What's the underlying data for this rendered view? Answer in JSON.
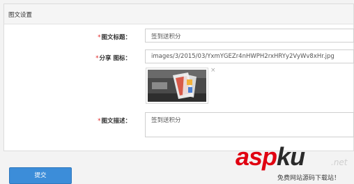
{
  "panel": {
    "title": "图文设置"
  },
  "form": {
    "required_mark": "*",
    "title_label": "图文标题：",
    "title_value": "签到送积分",
    "image_label": "分享 图标：",
    "image_value": "images/3/2015/03/YxmYGEZr4nHWPH2rxHRYy2VyWv8xHr.jpg",
    "remove_glyph": "×",
    "desc_label": "图文描述：",
    "desc_value": "签到送积分"
  },
  "submit_label": "提交",
  "watermark": {
    "text_a": "asp",
    "text_b": "ku",
    "suffix": ".net",
    "subtitle": "免费网站源码下载站！"
  },
  "colors": {
    "accent": "#3c8dd9",
    "required": "#e02020",
    "watermark_red": "#e00010"
  }
}
